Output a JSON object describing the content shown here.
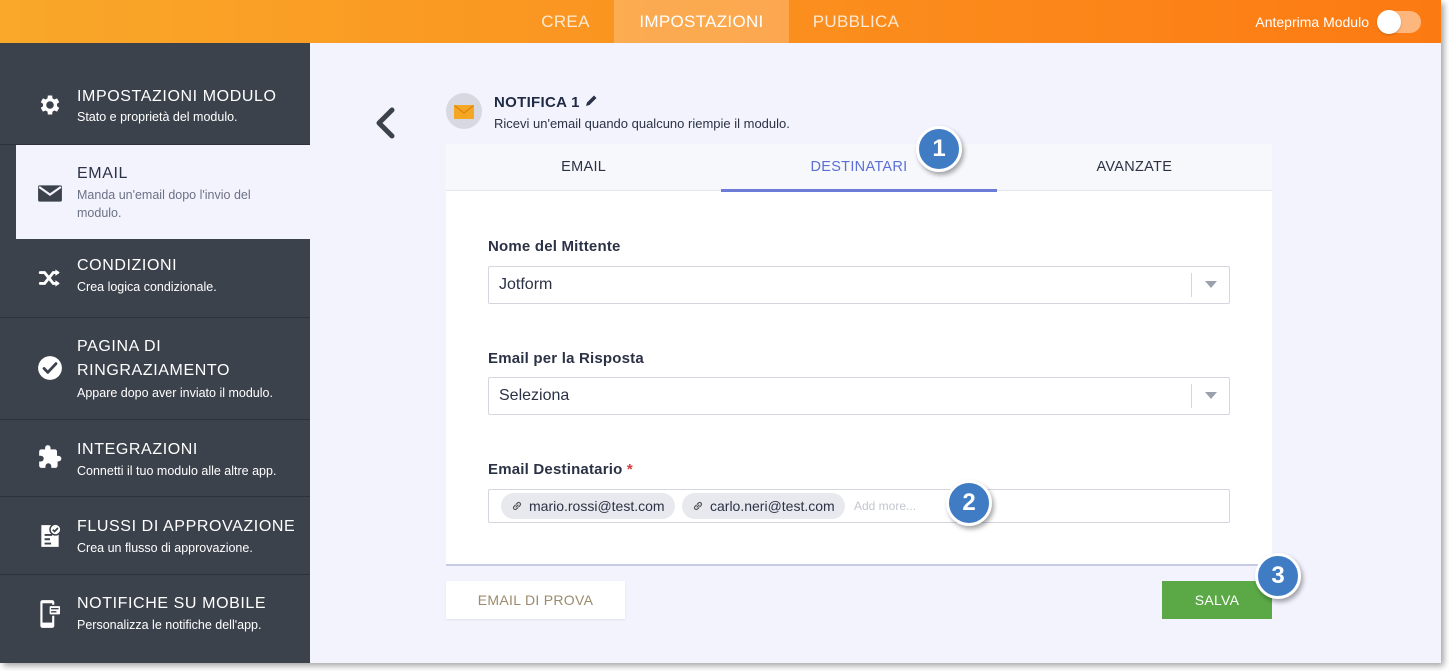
{
  "topbar": {
    "tabs": [
      "CREA",
      "IMPOSTAZIONI",
      "PUBBLICA"
    ],
    "active_tab": "IMPOSTAZIONI",
    "preview_label": "Anteprima Modulo",
    "preview_enabled": false,
    "gradient": [
      "#f9a829",
      "#fc7a12"
    ]
  },
  "sidebar": {
    "items": [
      {
        "title": "IMPOSTAZIONI MODULO",
        "desc": "Stato e proprietà del modulo.",
        "icon": "gear-icon"
      },
      {
        "title": "EMAIL",
        "desc": "Manda un'email dopo l'invio del modulo.",
        "icon": "envelope-icon",
        "active": true
      },
      {
        "title": "CONDIZIONI",
        "desc": "Crea logica condizionale.",
        "icon": "shuffle-icon"
      },
      {
        "title": "PAGINA DI RINGRAZIAMENTO",
        "desc": "Appare dopo aver inviato il modulo.",
        "icon": "check-circle-icon"
      },
      {
        "title": "INTEGRAZIONI",
        "desc": "Connetti il tuo modulo alle altre app.",
        "icon": "puzzle-icon"
      },
      {
        "title": "FLUSSI DI APPROVAZIONE",
        "desc": "Crea un flusso di approvazione.",
        "icon": "approval-icon"
      },
      {
        "title": "NOTIFICHE SU MOBILE",
        "desc": "Personalizza le notifiche dell'app.",
        "icon": "mobile-icon"
      }
    ]
  },
  "notification": {
    "title": "NOTIFICA 1",
    "subtitle": "Ricevi un'email quando qualcuno riempie il modulo."
  },
  "tabs": {
    "items": [
      "EMAIL",
      "DESTINATARI",
      "AVANZATE"
    ],
    "active": "DESTINATARI"
  },
  "form": {
    "sender_label": "Nome del Mittente",
    "sender_value": "Jotform",
    "reply_label": "Email per la Risposta",
    "reply_value": "Seleziona",
    "recipient_label": "Email Destinatario",
    "required_mark": "*",
    "recipients": [
      "mario.rossi@test.com",
      "carlo.neri@test.com"
    ],
    "add_more_placeholder": "Add more..."
  },
  "buttons": {
    "test_label": "EMAIL DI PROVA",
    "save_label": "SALVA"
  },
  "badges": [
    "1",
    "2",
    "3"
  ],
  "colors": {
    "accent": "#5b6fd6",
    "save": "#5aa946",
    "sidebar": "#3c424c",
    "badge": "#3f7cc3",
    "required": "#d9363e"
  }
}
